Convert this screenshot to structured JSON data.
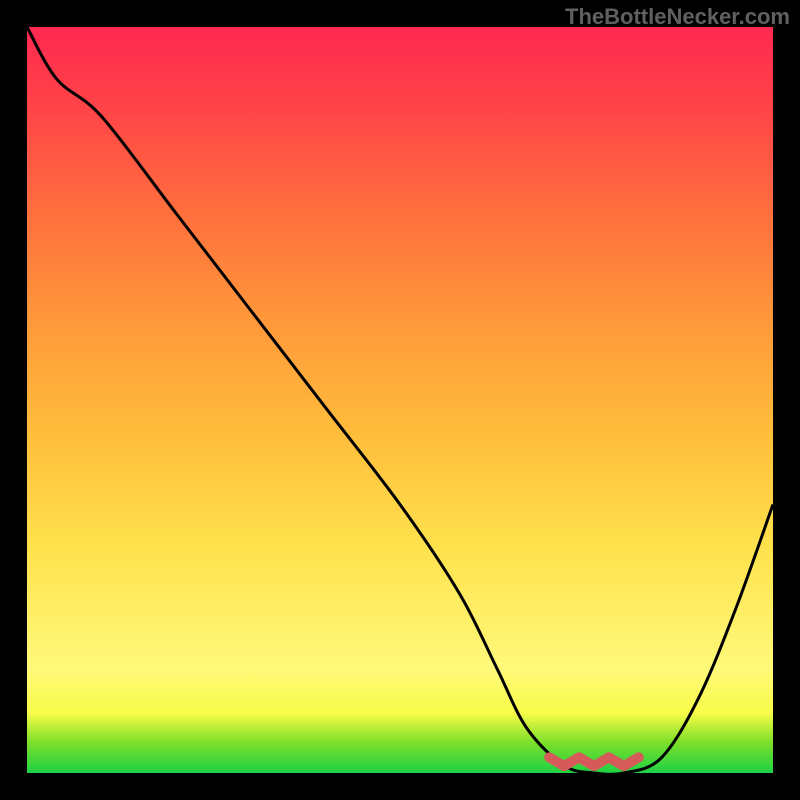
{
  "attribution": "TheBottleNecker.com",
  "chart_data": {
    "type": "line",
    "title": "",
    "xlabel": "",
    "ylabel": "",
    "xlim": [
      0,
      100
    ],
    "ylim": [
      0,
      100
    ],
    "series": [
      {
        "name": "curve",
        "x": [
          0,
          4,
          10,
          20,
          30,
          40,
          50,
          58,
          63,
          67,
          72,
          76,
          80,
          85,
          90,
          95,
          100
        ],
        "y": [
          100,
          93,
          88,
          75,
          62,
          49,
          36,
          24,
          14,
          6,
          1,
          0,
          0,
          2,
          10,
          22,
          36
        ]
      }
    ],
    "trough_marker": {
      "x_range": [
        70,
        82
      ],
      "y": 0
    },
    "gradient_stops": [
      {
        "offset": 0.0,
        "color": "#1ed145"
      },
      {
        "offset": 0.04,
        "color": "#7adf2a"
      },
      {
        "offset": 0.08,
        "color": "#f7fc47"
      },
      {
        "offset": 0.14,
        "color": "#fff97a"
      },
      {
        "offset": 0.3,
        "color": "#ffe24d"
      },
      {
        "offset": 0.45,
        "color": "#ffbe3c"
      },
      {
        "offset": 0.6,
        "color": "#ff9a3a"
      },
      {
        "offset": 0.75,
        "color": "#ff6f3d"
      },
      {
        "offset": 0.88,
        "color": "#ff4747"
      },
      {
        "offset": 1.0,
        "color": "#ff2850"
      }
    ]
  }
}
